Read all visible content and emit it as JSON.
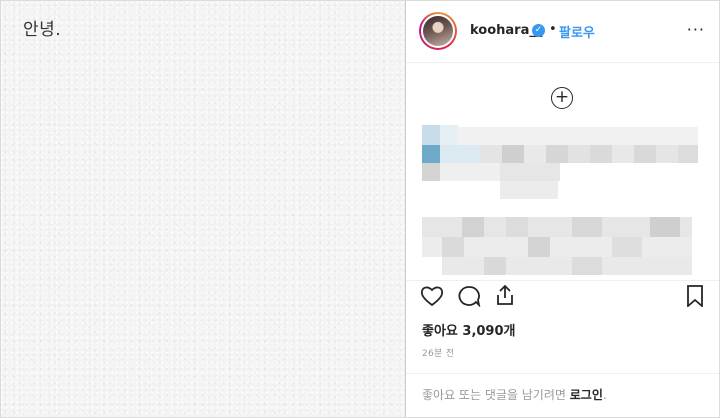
{
  "photo": {
    "text": "안녕."
  },
  "header": {
    "username": "koohara__",
    "verified_icon": "verified-badge-icon",
    "separator": "•",
    "follow_label": "팔로우",
    "more_icon": "more-options-icon",
    "more_label": "···"
  },
  "caption": {
    "add_icon": "plus-circle-icon",
    "add_label": "+"
  },
  "actions": {
    "like_icon": "heart-icon",
    "comment_icon": "comment-icon",
    "share_icon": "share-icon",
    "save_icon": "bookmark-icon"
  },
  "stats": {
    "likes_text": "좋아요 3,090개",
    "time_text": "26분 전"
  },
  "footer": {
    "prefix": "좋아요 또는 댓글을 남기려면 ",
    "login_label": "로그인",
    "suffix": "."
  },
  "colors": {
    "accent": "#3897f0",
    "text": "#262626",
    "muted": "#999999",
    "border": "#efefef"
  }
}
